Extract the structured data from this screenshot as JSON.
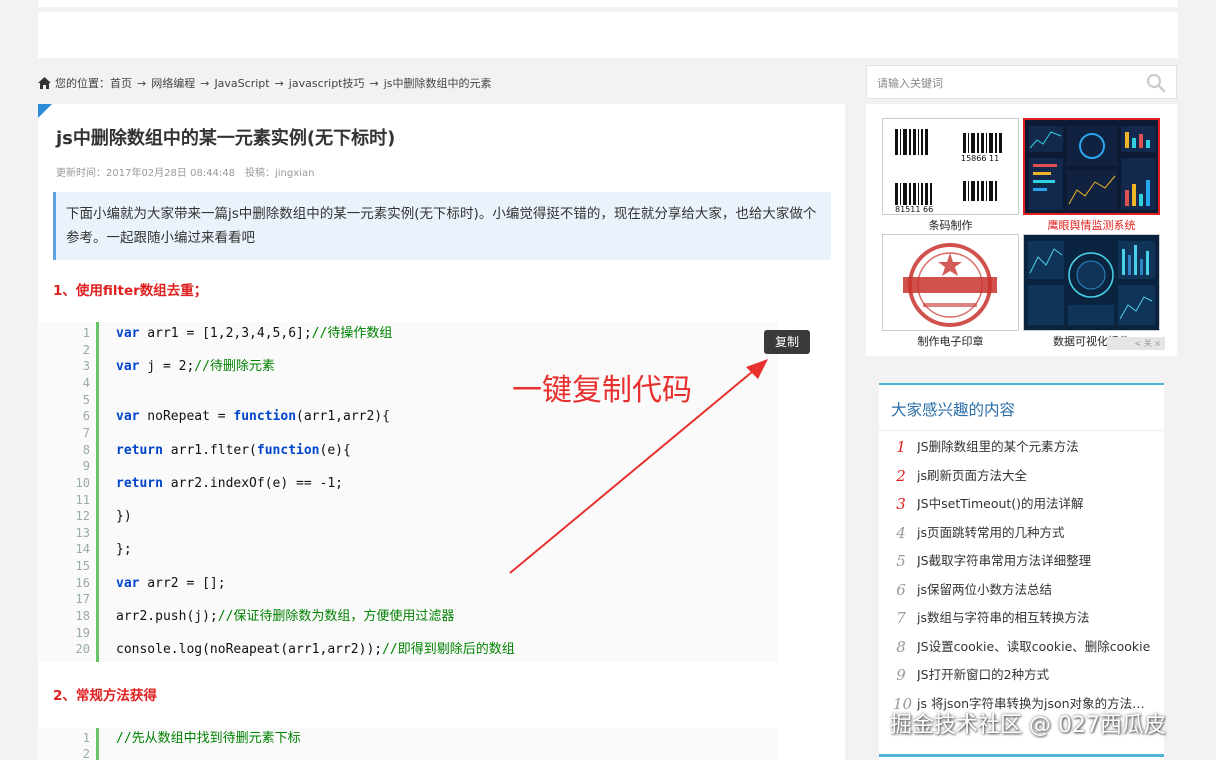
{
  "breadcrumb": {
    "prefix": "您的位置：",
    "items": [
      "首页",
      "网络编程",
      "JavaScript",
      "javascript技巧",
      "js中删除数组中的元素"
    ],
    "separator": "→"
  },
  "article": {
    "title": "js中删除数组中的某一元素实例(无下标时)",
    "meta_time_label": "更新时间：",
    "meta_time": "2017年02月28日 08:44:48",
    "meta_author_label": "投稿：",
    "meta_author": "jingxian",
    "intro": "下面小编就为大家带来一篇js中删除数组中的某一元素实例(无下标时)。小编觉得挺不错的，现在就分享给大家，也给大家做个参考。一起跟随小编过来看看吧",
    "section1_title": "1、使用filter数组去重；",
    "section2_title": "2、常规方法获得",
    "copy_button": "复制",
    "annotation": "一键复制代码",
    "code1": [
      {
        "n": "1",
        "html": "<span class=\"kw\">var</span> arr1 = [1,2,3,4,5,6];<span class=\"cm\">//待操作数组</span>"
      },
      {
        "n": "2",
        "html": ""
      },
      {
        "n": "3",
        "html": "<span class=\"kw\">var</span> j = 2;<span class=\"cm\">//待删除元素</span>"
      },
      {
        "n": "4",
        "html": ""
      },
      {
        "n": "5",
        "html": ""
      },
      {
        "n": "6",
        "html": "<span class=\"kw\">var</span> noRepeat = <span class=\"kw\">function</span>(arr1,arr2){"
      },
      {
        "n": "7",
        "html": ""
      },
      {
        "n": "8",
        "html": "<span class=\"kw\">return</span> arr1.flter(<span class=\"kw\">function</span>(e){"
      },
      {
        "n": "9",
        "html": ""
      },
      {
        "n": "10",
        "html": "<span class=\"kw\">return</span> arr2.indexOf(e) == -1;"
      },
      {
        "n": "11",
        "html": ""
      },
      {
        "n": "12",
        "html": "})"
      },
      {
        "n": "13",
        "html": ""
      },
      {
        "n": "14",
        "html": "};"
      },
      {
        "n": "15",
        "html": ""
      },
      {
        "n": "16",
        "html": "<span class=\"kw\">var</span> arr2 = [];"
      },
      {
        "n": "17",
        "html": ""
      },
      {
        "n": "18",
        "html": "arr2.push(j);<span class=\"cm\">//保证待删除数为数组，方便使用过滤器</span>"
      },
      {
        "n": "19",
        "html": ""
      },
      {
        "n": "20",
        "html": "console.log(noReapeat(arr1,arr2));<span class=\"cm\">//即得到剔除后的数组</span>"
      }
    ],
    "code2": [
      {
        "n": "1",
        "html": "<span class=\"cm\">//先从数组中找到待删元素下标</span>"
      },
      {
        "n": "2",
        "html": ""
      }
    ]
  },
  "sidebar": {
    "search_placeholder": "请输入关键词",
    "ads": [
      {
        "caption": "条码制作",
        "highlight": false
      },
      {
        "caption": "鹰眼舆情监测系统",
        "highlight": true
      },
      {
        "caption": "制作电子印章",
        "highlight": false
      },
      {
        "caption": "数据可视化插件",
        "highlight": false
      }
    ],
    "barcode_numbers": [
      "15866 11",
      "15866 11",
      "81511 66",
      "81511 66"
    ],
    "ad_controls": "< 关 ×",
    "interest_title": "大家感兴趣的内容",
    "interest_items": [
      {
        "num": "1",
        "text": "JS删除数组里的某个元素方法",
        "color": "#e02020"
      },
      {
        "num": "2",
        "text": "js刷新页面方法大全",
        "color": "#e02020"
      },
      {
        "num": "3",
        "text": "JS中setTimeout()的用法详解",
        "color": "#e02020"
      },
      {
        "num": "4",
        "text": "js页面跳转常用的几种方式",
        "color": "#999999"
      },
      {
        "num": "5",
        "text": "JS截取字符串常用方法详细整理",
        "color": "#999999"
      },
      {
        "num": "6",
        "text": "js保留两位小数方法总结",
        "color": "#999999"
      },
      {
        "num": "7",
        "text": "js数组与字符串的相互转换方法",
        "color": "#999999"
      },
      {
        "num": "8",
        "text": "JS设置cookie、读取cookie、删除cookie",
        "color": "#999999"
      },
      {
        "num": "9",
        "text": "JS打开新窗口的2种方式",
        "color": "#999999"
      },
      {
        "num": "10",
        "text": "js 将json字符串转换为json对象的方法解析",
        "color": "#999999"
      }
    ]
  },
  "watermark": "掘金技术社区 @ 027西瓜皮",
  "colors": {
    "accent_red": "#e02020",
    "link_blue": "#2b6ea8",
    "code_keyword": "#0044cc",
    "code_comment": "#008200",
    "code_bar": "#6ac46a"
  }
}
